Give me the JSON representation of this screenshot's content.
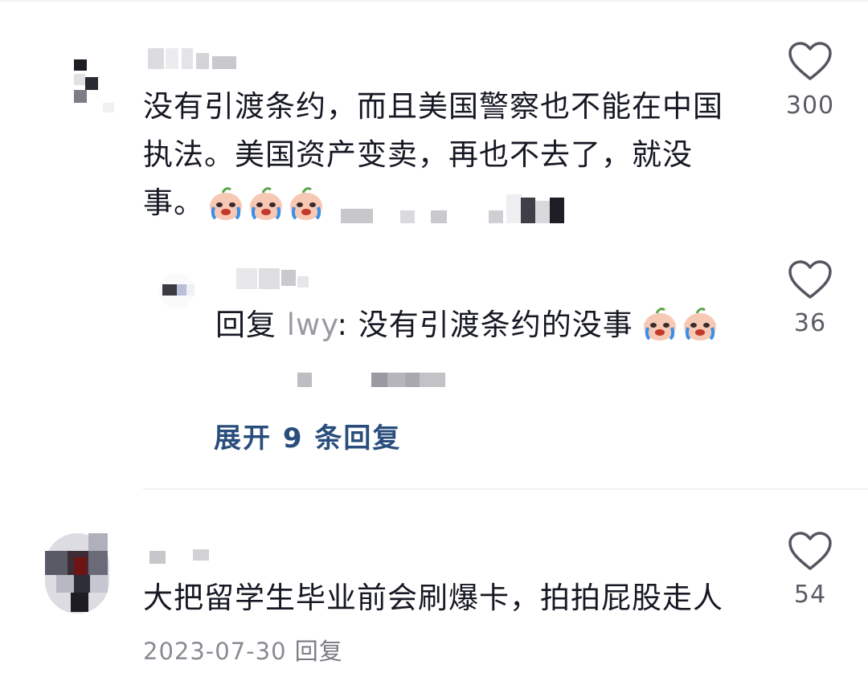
{
  "comments": [
    {
      "text_line1": "没有引渡条约，而且美国警察也不能在中国",
      "text_line2": "执法。美国资产变卖，再也不去了，就没",
      "text_line3": "事。",
      "emoji": "crying-face-emoji",
      "like_count": "300",
      "reply": {
        "prefix": "回复",
        "target_name": "lwy",
        "separator": ":",
        "text": "没有引渡条约的没事",
        "emoji": "crying-face-emoji",
        "like_count": "36"
      },
      "expand_label": "展开 9 条回复"
    },
    {
      "text": "大把留学生毕业前会刷爆卡，拍拍屁股走人",
      "like_count": "54",
      "date": "2023-07-30",
      "reply_label": "回复"
    }
  ],
  "icons": {
    "like": "heart-outline-icon"
  },
  "colors": {
    "text": "#161823",
    "secondary": "#8a8a93",
    "link": "#2a4e7c",
    "heart_stroke": "#555560"
  }
}
